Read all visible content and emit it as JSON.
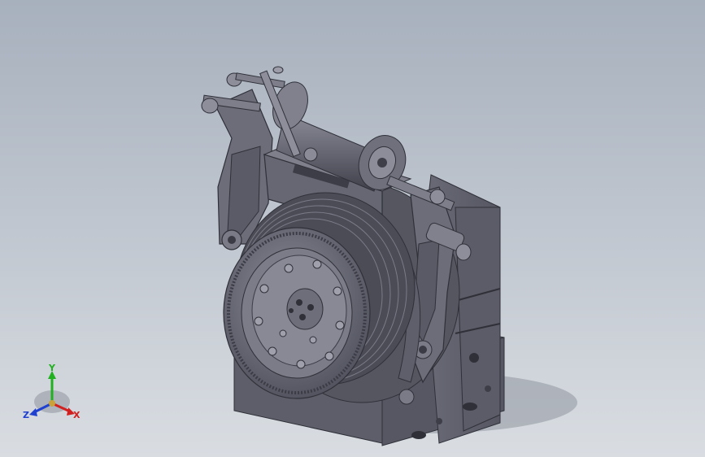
{
  "viewport": {
    "background_top": "#a7b0bd",
    "background_bottom": "#d9dde2"
  },
  "model": {
    "part_color": "#6b6c78",
    "shade_color": "#4a4b55",
    "highlight_color": "#8f909c"
  },
  "triad": {
    "x_label": "X",
    "y_label": "Y",
    "z_label": "Z",
    "x_color": "#d02020",
    "y_color": "#20b020",
    "z_color": "#2040d0"
  }
}
